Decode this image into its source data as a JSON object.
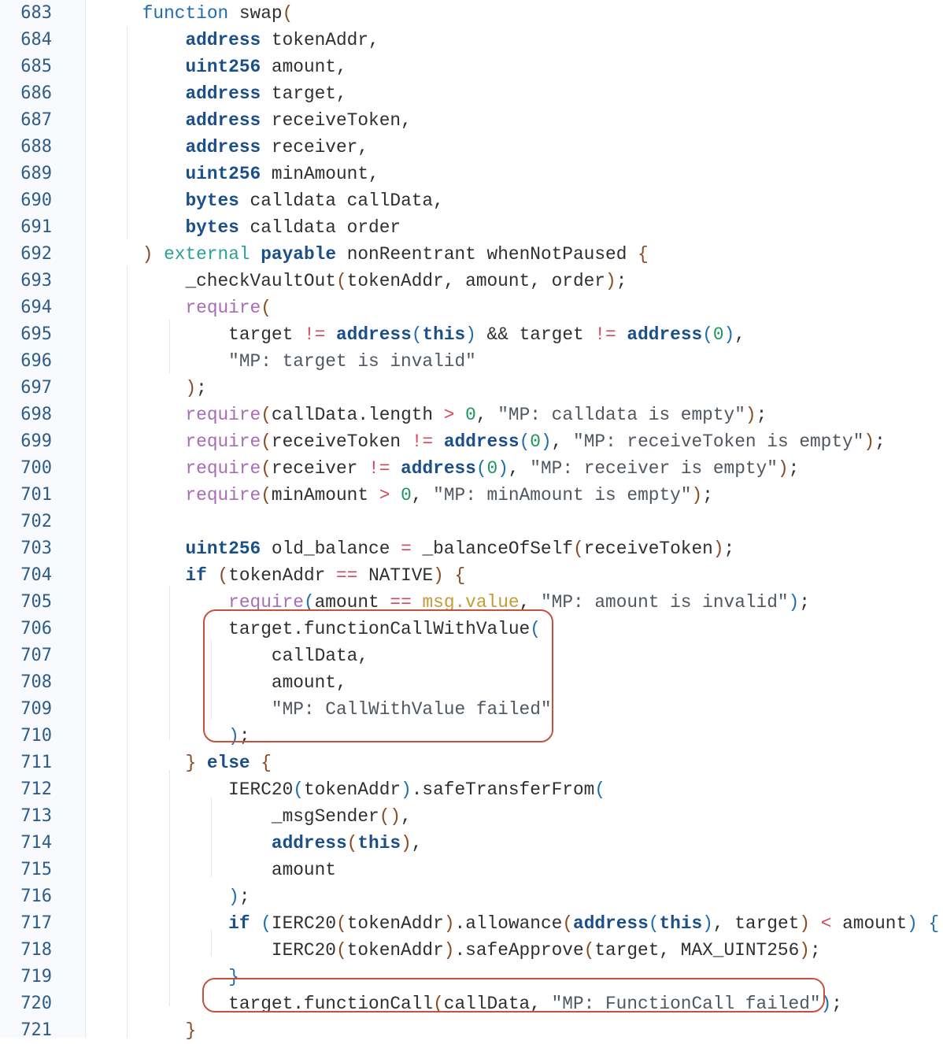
{
  "editor": {
    "first_line": 683,
    "lines": [
      [
        [
          "    ",
          ""
        ],
        [
          "function",
          "kw"
        ],
        [
          " swap",
          ""
        ],
        [
          "(",
          "br"
        ]
      ],
      [
        [
          "        ",
          ""
        ],
        [
          "address",
          "ty"
        ],
        [
          " tokenAddr,",
          ""
        ]
      ],
      [
        [
          "        ",
          ""
        ],
        [
          "uint256",
          "ty"
        ],
        [
          " amount,",
          ""
        ]
      ],
      [
        [
          "        ",
          ""
        ],
        [
          "address",
          "ty"
        ],
        [
          " target,",
          ""
        ]
      ],
      [
        [
          "        ",
          ""
        ],
        [
          "address",
          "ty"
        ],
        [
          " receiveToken,",
          ""
        ]
      ],
      [
        [
          "        ",
          ""
        ],
        [
          "address",
          "ty"
        ],
        [
          " receiver,",
          ""
        ]
      ],
      [
        [
          "        ",
          ""
        ],
        [
          "uint256",
          "ty"
        ],
        [
          " minAmount,",
          ""
        ]
      ],
      [
        [
          "        ",
          ""
        ],
        [
          "bytes",
          "ty"
        ],
        [
          " calldata callData,",
          ""
        ]
      ],
      [
        [
          "        ",
          ""
        ],
        [
          "bytes",
          "ty"
        ],
        [
          " calldata order",
          ""
        ]
      ],
      [
        [
          "    ",
          ""
        ],
        [
          ")",
          "br"
        ],
        [
          " ",
          ""
        ],
        [
          "external",
          "mo"
        ],
        [
          " ",
          ""
        ],
        [
          "payable",
          "ty"
        ],
        [
          " nonReentrant whenNotPaused ",
          ""
        ],
        [
          "{",
          "br"
        ]
      ],
      [
        [
          "        _checkVaultOut",
          ""
        ],
        [
          "(",
          "br"
        ],
        [
          "tokenAddr, amount, order",
          ""
        ],
        [
          ")",
          "br"
        ],
        [
          ";",
          ""
        ]
      ],
      [
        [
          "        ",
          ""
        ],
        [
          "require",
          "rq"
        ],
        [
          "(",
          "br"
        ]
      ],
      [
        [
          "            target ",
          ""
        ],
        [
          "!=",
          "op"
        ],
        [
          " ",
          ""
        ],
        [
          "address",
          "ty"
        ],
        [
          "(",
          "bb"
        ],
        [
          "this",
          "ty"
        ],
        [
          ")",
          "bb"
        ],
        [
          " && target ",
          ""
        ],
        [
          "!=",
          "op"
        ],
        [
          " ",
          ""
        ],
        [
          "address",
          "ty"
        ],
        [
          "(",
          "bb"
        ],
        [
          "0",
          "nu"
        ],
        [
          ")",
          "bb"
        ],
        [
          ",",
          ""
        ]
      ],
      [
        [
          "            ",
          ""
        ],
        [
          "\"MP: target is invalid\"",
          "st"
        ]
      ],
      [
        [
          "        ",
          ""
        ],
        [
          ")",
          "br"
        ],
        [
          ";",
          ""
        ]
      ],
      [
        [
          "        ",
          ""
        ],
        [
          "require",
          "rq"
        ],
        [
          "(",
          "br"
        ],
        [
          "callData.length ",
          ""
        ],
        [
          ">",
          "op"
        ],
        [
          " ",
          ""
        ],
        [
          "0",
          "nu"
        ],
        [
          ", ",
          ""
        ],
        [
          "\"MP: calldata is empty\"",
          "st"
        ],
        [
          ")",
          "br"
        ],
        [
          ";",
          ""
        ]
      ],
      [
        [
          "        ",
          ""
        ],
        [
          "require",
          "rq"
        ],
        [
          "(",
          "br"
        ],
        [
          "receiveToken ",
          ""
        ],
        [
          "!=",
          "op"
        ],
        [
          " ",
          ""
        ],
        [
          "address",
          "ty"
        ],
        [
          "(",
          "bb"
        ],
        [
          "0",
          "nu"
        ],
        [
          ")",
          "bb"
        ],
        [
          ", ",
          ""
        ],
        [
          "\"MP: receiveToken is empty\"",
          "st"
        ],
        [
          ")",
          "br"
        ],
        [
          ";",
          ""
        ]
      ],
      [
        [
          "        ",
          ""
        ],
        [
          "require",
          "rq"
        ],
        [
          "(",
          "br"
        ],
        [
          "receiver ",
          ""
        ],
        [
          "!=",
          "op"
        ],
        [
          " ",
          ""
        ],
        [
          "address",
          "ty"
        ],
        [
          "(",
          "bb"
        ],
        [
          "0",
          "nu"
        ],
        [
          ")",
          "bb"
        ],
        [
          ", ",
          ""
        ],
        [
          "\"MP: receiver is empty\"",
          "st"
        ],
        [
          ")",
          "br"
        ],
        [
          ";",
          ""
        ]
      ],
      [
        [
          "        ",
          ""
        ],
        [
          "require",
          "rq"
        ],
        [
          "(",
          "br"
        ],
        [
          "minAmount ",
          ""
        ],
        [
          ">",
          "op"
        ],
        [
          " ",
          ""
        ],
        [
          "0",
          "nu"
        ],
        [
          ", ",
          ""
        ],
        [
          "\"MP: minAmount is empty\"",
          "st"
        ],
        [
          ")",
          "br"
        ],
        [
          ";",
          ""
        ]
      ],
      [],
      [
        [
          "        ",
          ""
        ],
        [
          "uint256",
          "ty"
        ],
        [
          " old_balance ",
          ""
        ],
        [
          "=",
          "op"
        ],
        [
          " _balanceOfSelf",
          ""
        ],
        [
          "(",
          "br"
        ],
        [
          "receiveToken",
          ""
        ],
        [
          ")",
          "br"
        ],
        [
          ";",
          ""
        ]
      ],
      [
        [
          "        ",
          ""
        ],
        [
          "if",
          "ty"
        ],
        [
          " ",
          ""
        ],
        [
          "(",
          "br"
        ],
        [
          "tokenAddr ",
          ""
        ],
        [
          "==",
          "op"
        ],
        [
          " NATIVE",
          ""
        ],
        [
          ")",
          "br"
        ],
        [
          " ",
          ""
        ],
        [
          "{",
          "br"
        ]
      ],
      [
        [
          "            ",
          ""
        ],
        [
          "require",
          "rq"
        ],
        [
          "(",
          "bb"
        ],
        [
          "amount ",
          ""
        ],
        [
          "==",
          "op"
        ],
        [
          " ",
          ""
        ],
        [
          "msg.value",
          "mv"
        ],
        [
          ", ",
          ""
        ],
        [
          "\"MP: amount is invalid\"",
          "st"
        ],
        [
          ")",
          "bb"
        ],
        [
          ";",
          ""
        ]
      ],
      [
        [
          "            target.functionCallWithValue",
          ""
        ],
        [
          "(",
          "bb"
        ]
      ],
      [
        [
          "                callData,",
          ""
        ]
      ],
      [
        [
          "                amount,",
          ""
        ]
      ],
      [
        [
          "                ",
          ""
        ],
        [
          "\"MP: CallWithValue failed\"",
          "st"
        ]
      ],
      [
        [
          "            ",
          ""
        ],
        [
          ")",
          "bb"
        ],
        [
          ";",
          ""
        ]
      ],
      [
        [
          "        ",
          ""
        ],
        [
          "}",
          "br"
        ],
        [
          " ",
          ""
        ],
        [
          "else",
          "ty"
        ],
        [
          " ",
          ""
        ],
        [
          "{",
          "br"
        ]
      ],
      [
        [
          "            IERC20",
          ""
        ],
        [
          "(",
          "bb"
        ],
        [
          "tokenAddr",
          ""
        ],
        [
          ")",
          "bb"
        ],
        [
          ".safeTransferFrom",
          ""
        ],
        [
          "(",
          "bb"
        ]
      ],
      [
        [
          "                _msgSender",
          ""
        ],
        [
          "(",
          "br"
        ],
        [
          ")",
          "br"
        ],
        [
          ",",
          ""
        ]
      ],
      [
        [
          "                ",
          ""
        ],
        [
          "address",
          "ty"
        ],
        [
          "(",
          "br"
        ],
        [
          "this",
          "ty"
        ],
        [
          ")",
          "br"
        ],
        [
          ",",
          ""
        ]
      ],
      [
        [
          "                amount",
          ""
        ]
      ],
      [
        [
          "            ",
          ""
        ],
        [
          ")",
          "bb"
        ],
        [
          ";",
          ""
        ]
      ],
      [
        [
          "            ",
          ""
        ],
        [
          "if",
          "ty"
        ],
        [
          " ",
          ""
        ],
        [
          "(",
          "bb"
        ],
        [
          "IERC20",
          ""
        ],
        [
          "(",
          "br"
        ],
        [
          "tokenAddr",
          ""
        ],
        [
          ")",
          "br"
        ],
        [
          ".allowance",
          ""
        ],
        [
          "(",
          "br"
        ],
        [
          "address",
          "ty"
        ],
        [
          "(",
          "bb"
        ],
        [
          "this",
          "ty"
        ],
        [
          ")",
          "bb"
        ],
        [
          ", target",
          ""
        ],
        [
          ")",
          "br"
        ],
        [
          " ",
          ""
        ],
        [
          "<",
          "op"
        ],
        [
          " amount",
          ""
        ],
        [
          ")",
          "bb"
        ],
        [
          " ",
          ""
        ],
        [
          "{",
          "bb"
        ]
      ],
      [
        [
          "                IERC20",
          ""
        ],
        [
          "(",
          "br"
        ],
        [
          "tokenAddr",
          ""
        ],
        [
          ")",
          "br"
        ],
        [
          ".safeApprove",
          ""
        ],
        [
          "(",
          "br"
        ],
        [
          "target, MAX_UINT256",
          ""
        ],
        [
          ")",
          "br"
        ],
        [
          ";",
          ""
        ]
      ],
      [
        [
          "            ",
          ""
        ],
        [
          "}",
          "bb"
        ]
      ],
      [
        [
          "            target.functionCall",
          ""
        ],
        [
          "(",
          "br"
        ],
        [
          "callData, ",
          ""
        ],
        [
          "\"MP: FunctionCall failed\"",
          "st"
        ],
        [
          ")",
          "bb"
        ],
        [
          ";",
          ""
        ]
      ],
      [
        [
          "        ",
          ""
        ],
        [
          "}",
          "br"
        ]
      ]
    ]
  }
}
